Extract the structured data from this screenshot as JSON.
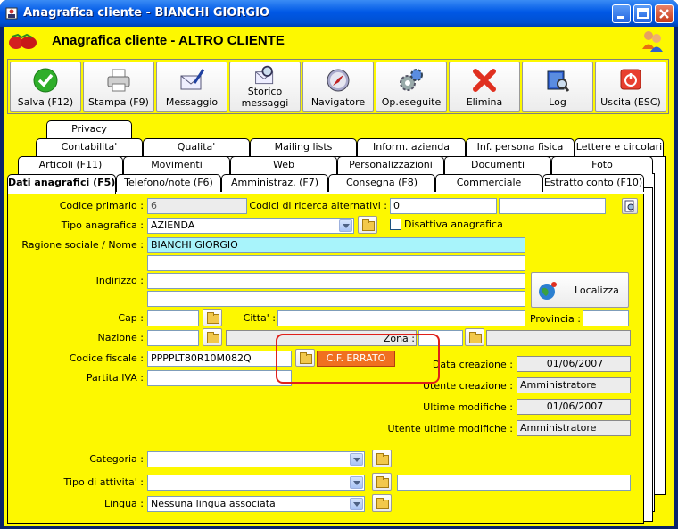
{
  "window": {
    "title": "Anagrafica cliente - BIANCHI GIORGIO"
  },
  "header": {
    "title": "Anagrafica cliente - ALTRO CLIENTE"
  },
  "toolbar": {
    "save": "Salva (F12)",
    "print": "Stampa (F9)",
    "message": "Messaggio",
    "history_1": "Storico",
    "history_2": "messaggi",
    "navigator": "Navigatore",
    "operations": "Op.eseguite",
    "delete": "Elimina",
    "log": "Log",
    "exit": "Uscita (ESC)"
  },
  "tabs": {
    "row5": [
      "Privacy"
    ],
    "row4": [
      "Contabilita'",
      "Qualita'",
      "Mailing lists",
      "Inform. azienda",
      "Inf. persona fisica",
      "Lettere e circolari"
    ],
    "row3": [
      "Articoli (F11)",
      "Movimenti",
      "Web",
      "Personalizzazioni",
      "Documenti",
      "Foto"
    ],
    "row2": [
      "Dati anagrafici (F5)",
      "Telefono/note (F6)",
      "Amministraz. (F7)",
      "Consegna (F8)",
      "Commerciale",
      "Estratto conto (F10)"
    ]
  },
  "form": {
    "primary_code_label": "Codice primario :",
    "primary_code_value": "6",
    "alt_codes_label": "Codici di ricerca alternativi :",
    "alt_code_1": "0",
    "alt_code_2": "",
    "type_label": "Tipo anagrafica :",
    "type_value": "AZIENDA",
    "disable_label": "Disattiva anagrafica",
    "name_label": "Ragione sociale / Nome :",
    "name_value": "BIANCHI GIORGIO",
    "name_value_2": "",
    "address_label": "Indirizzo :",
    "address_1": "",
    "address_2": "",
    "locate_label": "Localizza",
    "cap_label": "Cap :",
    "cap_value": "",
    "city_label": "Citta' :",
    "city_value": "",
    "province_label": "Provincia :",
    "province_value": "",
    "nation_label": "Nazione :",
    "nation_value": "",
    "zone_label": "Zona :",
    "zone_value": "",
    "tax_code_label": "Codice fiscale :",
    "tax_code_value": "PPPPLT80R10M082Q",
    "tax_code_error": "C.F. ERRATO",
    "vat_label": "Partita IVA :",
    "vat_value": "",
    "created_label": "Data creazione :",
    "created_value": "01/06/2007",
    "created_user_label": "Utente creazione :",
    "created_user_value": "Amministratore",
    "modified_label": "Ultime modifiche :",
    "modified_value": "01/06/2007",
    "modified_user_label": "Utente ultime modifiche :",
    "modified_user_value": "Amministratore",
    "category_label": "Categoria :",
    "category_value": "",
    "activity_label": "Tipo di attivita' :",
    "activity_value": "",
    "activity_extra": "",
    "language_label": "Lingua :",
    "language_value": "Nessuna lingua associata"
  },
  "colors": {
    "background": "#fdf800",
    "title_bar": "#0058e6",
    "error": "#f07020",
    "highlight": "#a8f4fb",
    "annotation": "#e0201a"
  }
}
